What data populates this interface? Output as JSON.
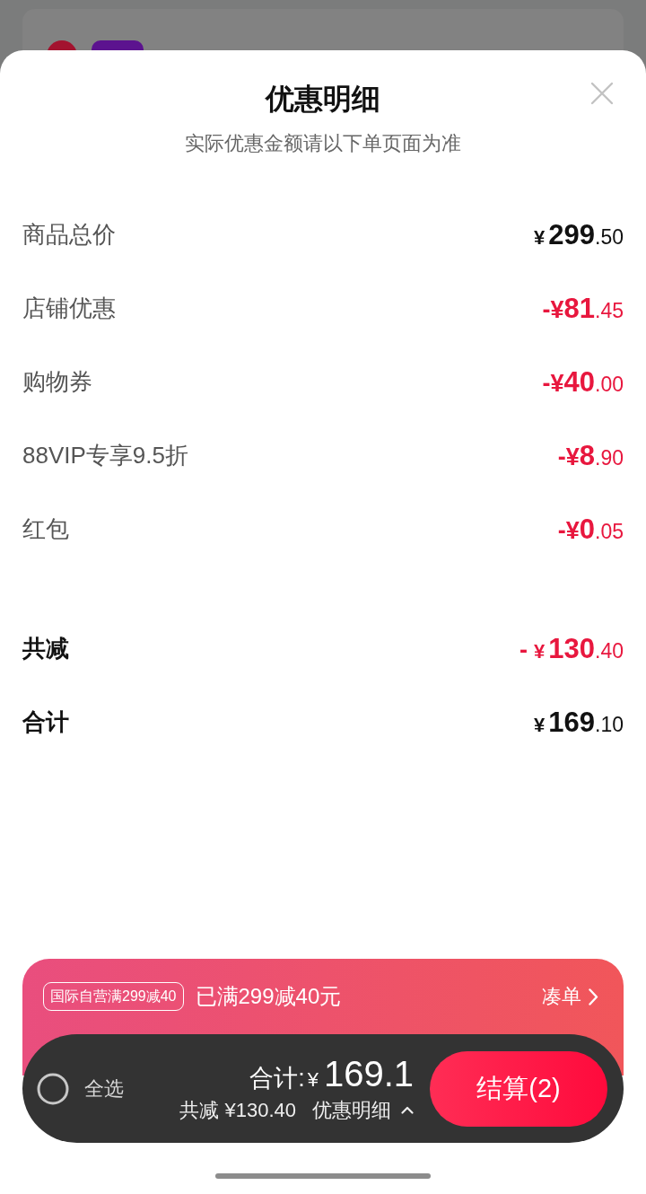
{
  "sheet": {
    "title": "优惠明细",
    "subtitle": "实际优惠金额请以下单页面为准"
  },
  "rows": [
    {
      "kind": "subtotal",
      "label": "商品总价",
      "amount": {
        "currency": "¥",
        "integer": "299",
        "decimal": ".50"
      }
    },
    {
      "kind": "discount",
      "label": "店铺优惠",
      "amount": {
        "sign": "-",
        "currency": "¥",
        "integer": "81",
        "decimal": ".45"
      }
    },
    {
      "kind": "discount",
      "label": "购物券",
      "amount": {
        "sign": "-",
        "currency": "¥",
        "integer": "40",
        "decimal": ".00"
      }
    },
    {
      "kind": "discount",
      "label": "88VIP专享9.5折",
      "amount": {
        "sign": "-",
        "currency": "¥",
        "integer": "8",
        "decimal": ".90"
      }
    },
    {
      "kind": "discount",
      "label": "红包",
      "amount": {
        "sign": "-",
        "currency": "¥",
        "integer": "0",
        "decimal": ".05"
      }
    }
  ],
  "summary": [
    {
      "kind": "saving",
      "label": "共减",
      "amount": {
        "sign": "-",
        "currency": "¥",
        "integer": "130",
        "decimal": ".40"
      }
    },
    {
      "kind": "total",
      "label": "合计",
      "amount": {
        "currency": "¥",
        "integer": "169",
        "decimal": ".10"
      }
    }
  ],
  "promo": {
    "tag": "国际自营满299减40",
    "message": "已满299减40元",
    "link": "凑单"
  },
  "checkout_bar": {
    "select_all": {
      "label": "全选",
      "checked": false
    },
    "total_label": "合计:",
    "currency": "¥",
    "total": "169.1",
    "savings": "共减 ¥130.40",
    "details": {
      "label": "优惠明细",
      "expanded": true
    },
    "button": "结算(2)"
  }
}
